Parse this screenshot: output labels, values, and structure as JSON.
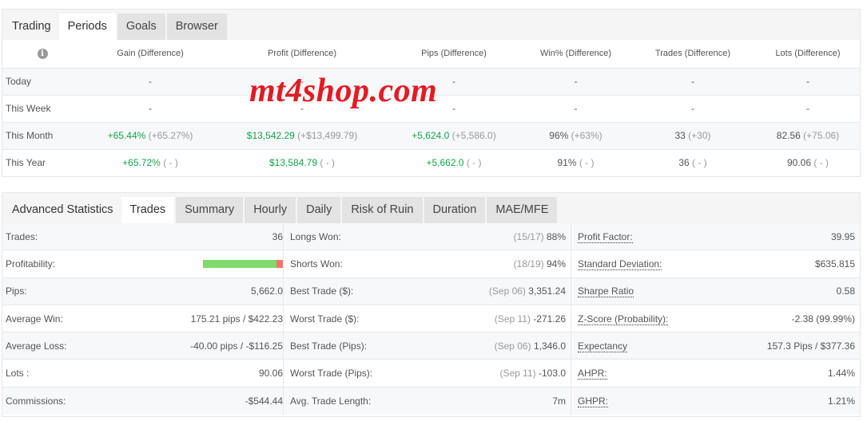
{
  "periods_panel": {
    "tabs": [
      {
        "label": "Trading",
        "type": "title"
      },
      {
        "label": "Periods",
        "active": true
      },
      {
        "label": "Goals",
        "active": false
      },
      {
        "label": "Browser",
        "active": false
      }
    ],
    "headers": [
      "Gain (Difference)",
      "Profit (Difference)",
      "Pips (Difference)",
      "Win% (Difference)",
      "Trades (Difference)",
      "Lots (Difference)"
    ],
    "info_icon": "info-icon",
    "rows": [
      {
        "label": "Today",
        "cells": [
          {
            "v": "-",
            "d": ""
          },
          {
            "v": "-",
            "d": ""
          },
          {
            "v": "-",
            "d": ""
          },
          {
            "v": "-",
            "d": ""
          },
          {
            "v": "-",
            "d": ""
          },
          {
            "v": "-",
            "d": ""
          }
        ]
      },
      {
        "label": "This Week",
        "cells": [
          {
            "v": "-",
            "d": ""
          },
          {
            "v": "-",
            "d": ""
          },
          {
            "v": "-",
            "d": ""
          },
          {
            "v": "-",
            "d": ""
          },
          {
            "v": "-",
            "d": ""
          },
          {
            "v": "-",
            "d": ""
          }
        ]
      },
      {
        "label": "This Month",
        "cells": [
          {
            "v": "+65.44%",
            "d": " (+65.27%)",
            "green": true
          },
          {
            "v": "$13,542.29",
            "d": " (+$13,499.79)",
            "green": true
          },
          {
            "v": "+5,624.0",
            "d": " (+5,586.0)",
            "green": true
          },
          {
            "v": "96%",
            "d": " (+63%)"
          },
          {
            "v": "33",
            "d": " (+30)"
          },
          {
            "v": "82.56",
            "d": " (+75.06)"
          }
        ]
      },
      {
        "label": "This Year",
        "cells": [
          {
            "v": "+65.72%",
            "d": " ( - )",
            "green": true
          },
          {
            "v": "$13,584.79",
            "d": " ( - )",
            "green": true
          },
          {
            "v": "+5,662.0",
            "d": " ( - )",
            "green": true
          },
          {
            "v": "91%",
            "d": " ( - )"
          },
          {
            "v": "36",
            "d": " ( - )"
          },
          {
            "v": "90.06",
            "d": " ( - )"
          }
        ]
      }
    ]
  },
  "watermark": "mt4shop.com",
  "advanced_panel": {
    "title": "Advanced Statistics",
    "tabs": [
      {
        "label": "Trades",
        "active": true
      },
      {
        "label": "Summary",
        "active": false
      },
      {
        "label": "Hourly",
        "active": false
      },
      {
        "label": "Daily",
        "active": false
      },
      {
        "label": "Risk of Ruin",
        "active": false
      },
      {
        "label": "Duration",
        "active": false
      },
      {
        "label": "MAE/MFE",
        "active": false
      }
    ],
    "col1": [
      {
        "label": "Trades:",
        "value": "36"
      },
      {
        "label": "Profitability:",
        "bar": {
          "win_fraction": 0.917,
          "win_color": "#7fdb6e",
          "loss_color": "#f2766a"
        }
      },
      {
        "label": "Pips:",
        "value": "5,662.0"
      },
      {
        "label": "Average Win:",
        "value": "175.21 pips / $422.23"
      },
      {
        "label": "Average Loss:",
        "value": "-40.00 pips / -$116.25"
      },
      {
        "label": "Lots :",
        "value": "90.06"
      },
      {
        "label": "Commissions:",
        "value": "-$544.44"
      }
    ],
    "col2": [
      {
        "label": "Longs Won:",
        "sub": "(15/17)",
        "value": "88%"
      },
      {
        "label": "Shorts Won:",
        "sub": "(18/19)",
        "value": "94%"
      },
      {
        "label": "Best Trade ($):",
        "sub": "(Sep 06)",
        "value": "3,351.24"
      },
      {
        "label": "Worst Trade ($):",
        "sub": "(Sep 11)",
        "value": "-271.26"
      },
      {
        "label": "Best Trade (Pips):",
        "sub": "(Sep 06)",
        "value": "1,346.0"
      },
      {
        "label": "Worst Trade (Pips):",
        "sub": "(Sep 11)",
        "value": "-103.0"
      },
      {
        "label": "Avg. Trade Length:",
        "sub": "",
        "value": "7m"
      }
    ],
    "col3": [
      {
        "label": "Profit Factor:",
        "value": "39.95"
      },
      {
        "label": "Standard Deviation:",
        "value": "$635.815"
      },
      {
        "label": "Sharpe Ratio",
        "value": "0.58"
      },
      {
        "label": "Z-Score (Probability):",
        "value": "-2.38 (99.99%)"
      },
      {
        "label": "Expectancy",
        "value": "157.3 Pips / $377.36"
      },
      {
        "label": "AHPR:",
        "value": "1.44%"
      },
      {
        "label": "GHPR:",
        "value": "1.21%"
      }
    ]
  }
}
